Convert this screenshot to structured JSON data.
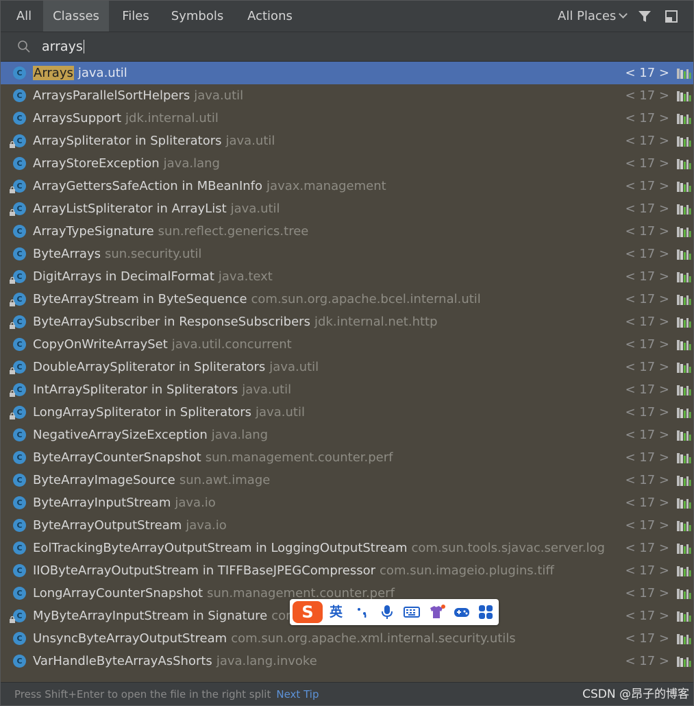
{
  "tabs": [
    {
      "label": "All",
      "active": false
    },
    {
      "label": "Classes",
      "active": true
    },
    {
      "label": "Files",
      "active": false
    },
    {
      "label": "Symbols",
      "active": false
    },
    {
      "label": "Actions",
      "active": false
    }
  ],
  "scope": {
    "label": "All Places"
  },
  "search": {
    "query": "arrays"
  },
  "results": [
    {
      "name": "Arrays",
      "pkg": "java.util",
      "ver": "< 17 >",
      "lock": false
    },
    {
      "name": "ArraysParallelSortHelpers",
      "pkg": "java.util",
      "ver": "< 17 >",
      "lock": false
    },
    {
      "name": "ArraysSupport",
      "pkg": "jdk.internal.util",
      "ver": "< 17 >",
      "lock": false
    },
    {
      "name": "ArraySpliterator in Spliterators",
      "pkg": "java.util",
      "ver": "< 17 >",
      "lock": true
    },
    {
      "name": "ArrayStoreException",
      "pkg": "java.lang",
      "ver": "< 17 >",
      "lock": false
    },
    {
      "name": "ArrayGettersSafeAction in MBeanInfo",
      "pkg": "javax.management",
      "ver": "< 17 >",
      "lock": true
    },
    {
      "name": "ArrayListSpliterator in ArrayList",
      "pkg": "java.util",
      "ver": "< 17 >",
      "lock": true
    },
    {
      "name": "ArrayTypeSignature",
      "pkg": "sun.reflect.generics.tree",
      "ver": "< 17 >",
      "lock": false
    },
    {
      "name": "ByteArrays",
      "pkg": "sun.security.util",
      "ver": "< 17 >",
      "lock": false
    },
    {
      "name": "DigitArrays in DecimalFormat",
      "pkg": "java.text",
      "ver": "< 17 >",
      "lock": true
    },
    {
      "name": "ByteArrayStream in ByteSequence",
      "pkg": "com.sun.org.apache.bcel.internal.util",
      "ver": "< 17 >",
      "lock": true
    },
    {
      "name": "ByteArraySubscriber in ResponseSubscribers",
      "pkg": "jdk.internal.net.http",
      "ver": "< 17 >",
      "lock": true
    },
    {
      "name": "CopyOnWriteArraySet",
      "pkg": "java.util.concurrent",
      "ver": "< 17 >",
      "lock": false
    },
    {
      "name": "DoubleArraySpliterator in Spliterators",
      "pkg": "java.util",
      "ver": "< 17 >",
      "lock": true
    },
    {
      "name": "IntArraySpliterator in Spliterators",
      "pkg": "java.util",
      "ver": "< 17 >",
      "lock": true
    },
    {
      "name": "LongArraySpliterator in Spliterators",
      "pkg": "java.util",
      "ver": "< 17 >",
      "lock": true
    },
    {
      "name": "NegativeArraySizeException",
      "pkg": "java.lang",
      "ver": "< 17 >",
      "lock": false
    },
    {
      "name": "ByteArrayCounterSnapshot",
      "pkg": "sun.management.counter.perf",
      "ver": "< 17 >",
      "lock": false
    },
    {
      "name": "ByteArrayImageSource",
      "pkg": "sun.awt.image",
      "ver": "< 17 >",
      "lock": false
    },
    {
      "name": "ByteArrayInputStream",
      "pkg": "java.io",
      "ver": "< 17 >",
      "lock": false
    },
    {
      "name": "ByteArrayOutputStream",
      "pkg": "java.io",
      "ver": "< 17 >",
      "lock": false
    },
    {
      "name": "EolTrackingByteArrayOutputStream in LoggingOutputStream",
      "pkg": "com.sun.tools.sjavac.server.log",
      "ver": "< 17 >",
      "lock": false
    },
    {
      "name": "IIOByteArrayOutputStream in TIFFBaseJPEGCompressor",
      "pkg": "com.sun.imageio.plugins.tiff",
      "ver": "< 17 >",
      "lock": false
    },
    {
      "name": "LongArrayCounterSnapshot",
      "pkg": "sun.management.counter.perf",
      "ver": "< 17 >",
      "lock": false
    },
    {
      "name": "MyByteArrayInputStream in Signature",
      "pkg": "com.s",
      "ver": "< 17 >",
      "lock": true
    },
    {
      "name": "UnsyncByteArrayOutputStream",
      "pkg": "com.sun.org.apache.xml.internal.security.utils",
      "ver": "< 17 >",
      "lock": false
    },
    {
      "name": "VarHandleByteArrayAsShorts",
      "pkg": "java.lang.invoke",
      "ver": "< 17 >",
      "lock": false
    }
  ],
  "status": {
    "hint": "Press Shift+Enter to open the file in the right split",
    "next_tip": "Next Tip"
  },
  "watermark": "CSDN @昂子的博客",
  "ime": {
    "lang": "英"
  },
  "colors": {
    "selection": "#4b6eaf",
    "list_bg": "#4b473e",
    "class_icon": "#3d8ecb",
    "match_highlight": "#c2a04f"
  }
}
